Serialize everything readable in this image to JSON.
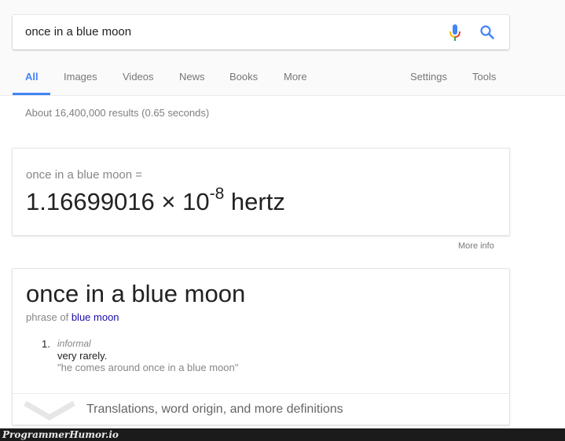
{
  "search": {
    "query": "once in a blue moon",
    "mic_icon": "microphone-icon",
    "search_icon": "magnifier-icon"
  },
  "tabs": {
    "items": [
      {
        "label": "All",
        "active": true
      },
      {
        "label": "Images"
      },
      {
        "label": "Videos"
      },
      {
        "label": "News"
      },
      {
        "label": "Books"
      },
      {
        "label": "More"
      }
    ],
    "settings": "Settings",
    "tools": "Tools"
  },
  "stats": "About 16,400,000 results (0.65 seconds)",
  "calculator": {
    "query": "once in a blue moon =",
    "mantissa": "1.16699016 × 10",
    "exponent": "-8",
    "unit": "hertz",
    "more_info": "More info"
  },
  "dictionary": {
    "word": "once in a blue moon",
    "phrase_prefix": "phrase of",
    "phrase_link": "blue moon",
    "definitions": [
      {
        "number": "1.",
        "label": "informal",
        "text": "very rarely.",
        "example": "\"he comes around once in a blue moon\""
      }
    ],
    "footer": "Translations, word origin, and more definitions"
  },
  "watermark": "ProgrammerHumor.io",
  "colors": {
    "accent": "#4285f4",
    "link": "#1a0dab"
  }
}
